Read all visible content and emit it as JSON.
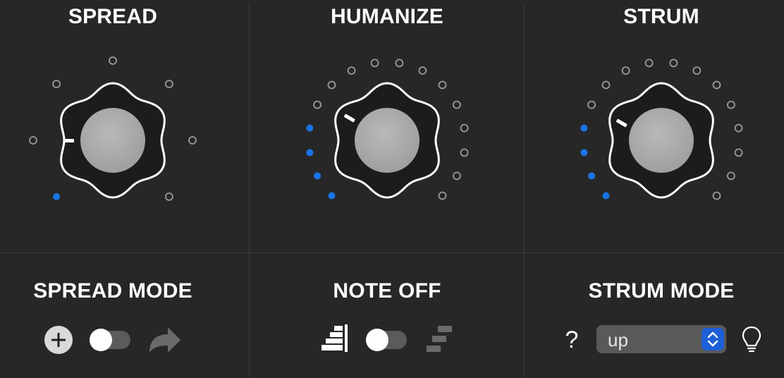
{
  "sections": {
    "spread": {
      "title": "SPREAD"
    },
    "humanize": {
      "title": "HUMANIZE"
    },
    "strum": {
      "title": "STRUM"
    },
    "spread_mode": {
      "title": "SPREAD MODE",
      "toggle_on": false
    },
    "note_off": {
      "title": "NOTE OFF",
      "toggle_on": false
    },
    "strum_mode": {
      "title": "STRUM MODE",
      "select_value": "up",
      "help_label": "?"
    }
  },
  "knobs": {
    "spread": {
      "steps": 7,
      "active_steps": 1
    },
    "humanize": {
      "steps": 16,
      "active_steps": 4
    },
    "strum": {
      "steps": 16,
      "active_steps": 4
    }
  },
  "icons": {
    "spread_mode_left": "plus-circle-icon",
    "spread_mode_right": "arrow-turn-right-icon",
    "note_off_left": "stacked-bars-icon",
    "note_off_right": "staggered-steps-icon",
    "strum_mode_left": "question-mark-icon",
    "strum_mode_right": "lightbulb-icon"
  },
  "colors": {
    "background": "#272727",
    "active_dot": "#1a74e6",
    "inactive_dot": "#9a9a9a",
    "select_stepper": "#1d5fd6"
  }
}
